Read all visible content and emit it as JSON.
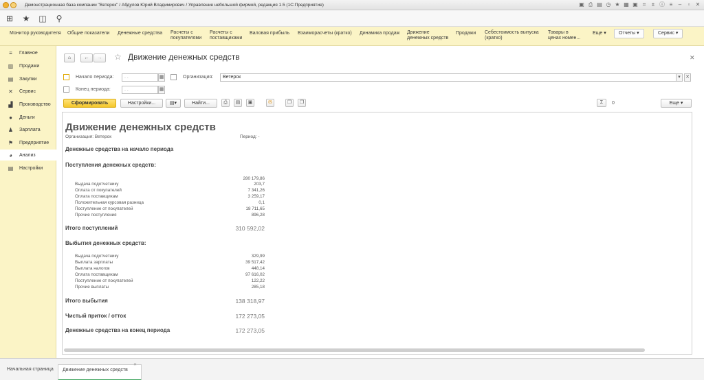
{
  "window": {
    "title": "Демонстрационная база компании \"Ветерок\" / Абдулов Юрий Владимирович / Управление небольшой фирмой, редакция 1.5 (1С:Предприятие)"
  },
  "sections": [
    {
      "label": "Монитор руководителя"
    },
    {
      "label": "Общие показатели"
    },
    {
      "label": "Денежные средства"
    },
    {
      "label": "Расчеты с покупателями"
    },
    {
      "label": "Расчеты с поставщиками"
    },
    {
      "label": "Валовая прибыль"
    },
    {
      "label": "Взаиморасчеты (кратко)"
    },
    {
      "label": "Динамика продаж"
    },
    {
      "label": "Движение денежных средств"
    },
    {
      "label": "Продажи"
    },
    {
      "label": "Себестоимость выпуска (кратко)"
    },
    {
      "label": "Товары в ценах номен..."
    }
  ],
  "section_buttons": {
    "more": "Еще ▾",
    "reports": "Отчеты ▾",
    "service": "Сервис ▾"
  },
  "sidebar": {
    "items": [
      {
        "label": "Главное",
        "icon": "list-icon"
      },
      {
        "label": "Продажи",
        "icon": "basket-icon"
      },
      {
        "label": "Закупки",
        "icon": "cart-icon"
      },
      {
        "label": "Сервис",
        "icon": "tools-icon"
      },
      {
        "label": "Производство",
        "icon": "factory-icon"
      },
      {
        "label": "Деньги",
        "icon": "money-icon"
      },
      {
        "label": "Зарплата",
        "icon": "people-icon"
      },
      {
        "label": "Предприятие",
        "icon": "flag-icon"
      },
      {
        "label": "Анализ",
        "icon": "chart-icon",
        "active": true
      },
      {
        "label": "Настройки",
        "icon": "gear-icon"
      }
    ]
  },
  "form": {
    "title": "Движение денежных средств",
    "start_label": "Начало периода:",
    "end_label": "Конец периода:",
    "date_placeholder": " .  .",
    "org_label": "Организация:",
    "org_value": "Ветерок",
    "generate_button": "Сформировать",
    "settings_button": "Настройки...",
    "find_button": "Найти...",
    "sum_value": "0",
    "more_button": "Еще ▾"
  },
  "report": {
    "title": "Движение денежных средств",
    "org_line": "Организация: Ветерок",
    "period_line": "Период: -",
    "start_balance_label": "Денежные средства на начало периода",
    "income_header": "Поступления денежных средств:",
    "income_top_value": "280 179,86",
    "income_rows": [
      {
        "label": "Выдача подотчетнику",
        "value": "203,7"
      },
      {
        "label": "Оплата от покупателей",
        "value": "7 341,26"
      },
      {
        "label": "Оплата поставщикам",
        "value": "3 259,17"
      },
      {
        "label": "Положительная курсовая разница",
        "value": "0,1"
      },
      {
        "label": "Поступление от покупателей",
        "value": "18 711,65"
      },
      {
        "label": "Прочие поступления",
        "value": "896,28"
      }
    ],
    "income_total": {
      "label": "Итого поступлений",
      "value": "310 592,02"
    },
    "outflow_header": "Выбытия денежных средств:",
    "outflow_rows": [
      {
        "label": "Выдача подотчетнику",
        "value": "329,99"
      },
      {
        "label": "Выплата зарплаты",
        "value": "39 517,42"
      },
      {
        "label": "Выплата налогов",
        "value": "448,14"
      },
      {
        "label": "Оплата поставщикам",
        "value": "97 616,02"
      },
      {
        "label": "Поступление от покупателей",
        "value": "122,22"
      },
      {
        "label": "Прочие выплаты",
        "value": "285,18"
      }
    ],
    "outflow_total": {
      "label": "Итого выбытия",
      "value": "138 318,97"
    },
    "net_flow": {
      "label": "Чистый приток / отток",
      "value": "172 273,05"
    },
    "end_balance": {
      "label": "Денежные средства на конец периода",
      "value": "172 273,05"
    }
  },
  "bottom_tabs": [
    {
      "label": "Начальная страница"
    },
    {
      "label": "Движение денежных средств",
      "active": true
    }
  ]
}
